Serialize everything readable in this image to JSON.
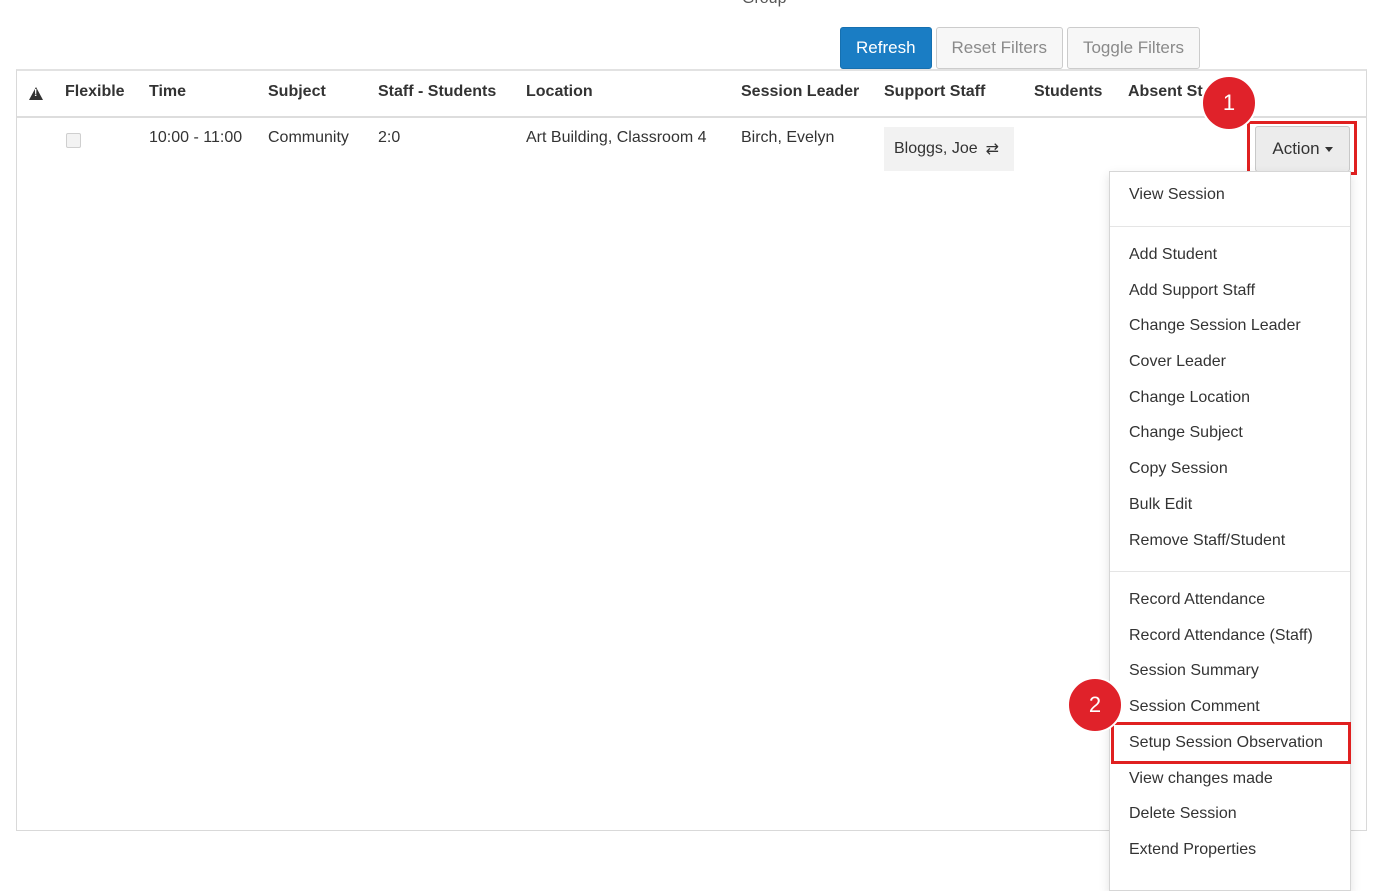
{
  "header": {
    "group_label": "Group"
  },
  "toolbar": {
    "refresh": "Refresh",
    "reset_filters": "Reset Filters",
    "toggle_filters": "Toggle Filters"
  },
  "table": {
    "columns": [
      "Flexible",
      "Time",
      "Subject",
      "Staff - Students",
      "Location",
      "Session Leader",
      "Support Staff",
      "Students",
      "Absent St"
    ],
    "row": {
      "flexible": false,
      "time": "10:00 - 11:00",
      "subject": "Community",
      "staff_students": "2:0",
      "location": "Art Building, Classroom 4",
      "session_leader": "Birch, Evelyn",
      "support_staff": "Bloggs, Joe",
      "action": "Action"
    }
  },
  "menu": {
    "items": [
      "View Session",
      "Add Student",
      "Add Support Staff",
      "Change Session Leader",
      "Cover Leader",
      "Change Location",
      "Change Subject",
      "Copy Session",
      "Bulk Edit",
      "Remove Staff/Student",
      "Record Attendance",
      "Record Attendance (Staff)",
      "Session Summary",
      "Session Comment",
      "Setup Session Observation",
      "View changes made",
      "Delete Session",
      "Extend Properties"
    ]
  },
  "callouts": {
    "step1": "1",
    "step2": "2"
  },
  "colors": {
    "primary": "#1a7dc4",
    "callout": "#e0222a"
  },
  "icons": {
    "warning": "warning-icon",
    "swap": "swap-icon",
    "caret": "caret-down-icon"
  }
}
